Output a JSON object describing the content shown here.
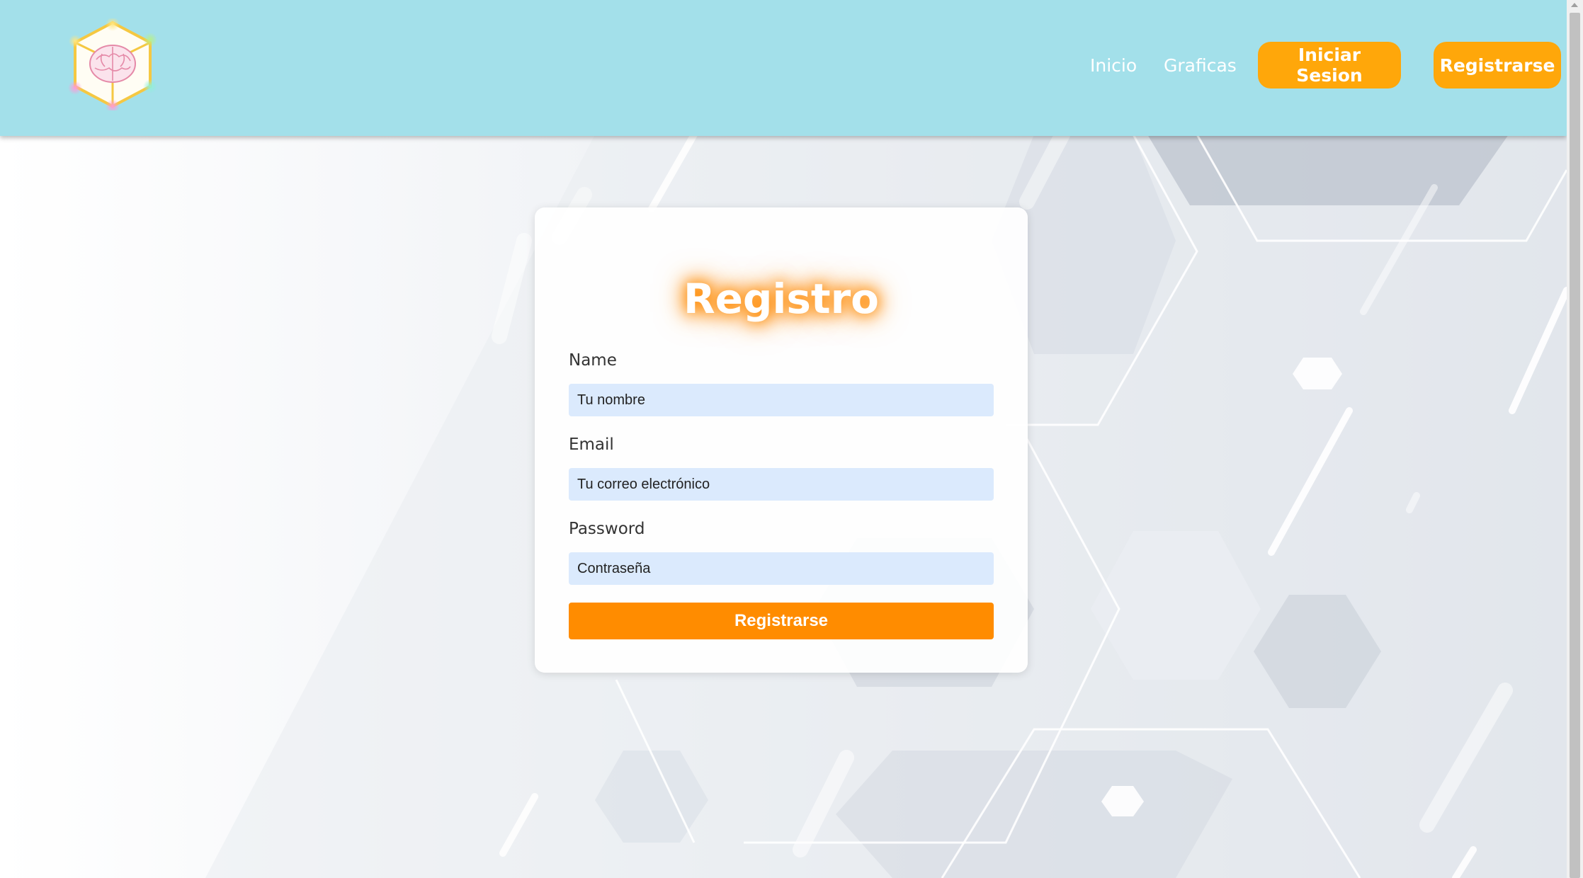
{
  "nav": {
    "logo": "brain-cube-logo",
    "links": {
      "home": "Inicio",
      "charts": "Graficas"
    },
    "buttons": {
      "login": "Iniciar Sesion",
      "register": "Registrarse"
    }
  },
  "form": {
    "title": "Registro",
    "fields": {
      "name": {
        "label": "Name",
        "placeholder": "Tu nombre"
      },
      "email": {
        "label": "Email",
        "placeholder": "Tu correo electrónico"
      },
      "password": {
        "label": "Password",
        "placeholder": "Contraseña"
      }
    },
    "submit": "Registrarse"
  },
  "colors": {
    "navbar": "#a3e0ea",
    "accent": "#ffa70a",
    "submit": "#ff8c00",
    "input_bg": "#dbeafd"
  }
}
